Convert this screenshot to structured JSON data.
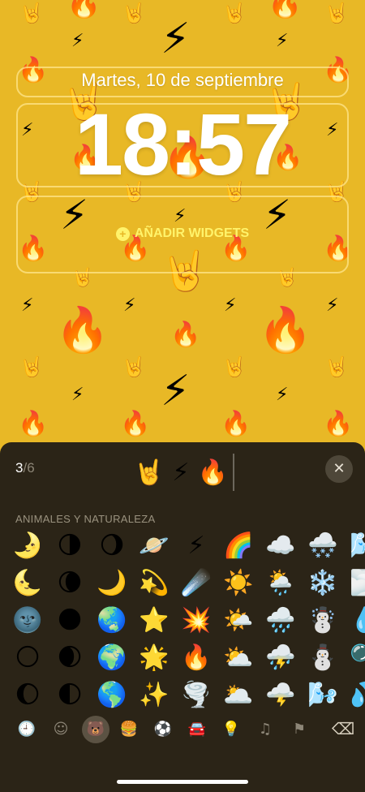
{
  "lockscreen": {
    "date": "Martes, 10 de septiembre",
    "time": "18:57",
    "add_widgets": "AÑADIR WIDGETS",
    "add_icon": "plus-circle-icon",
    "background_color": "#e8b826"
  },
  "picker": {
    "counter_current": "3",
    "counter_total": "/6",
    "selected_emojis": [
      "🤘",
      "⚡",
      "🔥"
    ],
    "close_icon": "close-icon",
    "category_title": "ANIMALES Y NATURALEZA",
    "emoji_rows": [
      [
        "🌛",
        "🌗",
        "🌖",
        "🪐",
        "⚡",
        "🌈",
        "☁️",
        "🌨️",
        "🌬️"
      ],
      [
        "🌜",
        "🌘",
        "🌙",
        "💫",
        "☄️",
        "☀️",
        "🌦️",
        "❄️",
        "🌫️"
      ],
      [
        "🌚",
        "🌑",
        "🌏",
        "⭐",
        "💥",
        "🌤️",
        "🌧️",
        "☃️",
        "💧"
      ],
      [
        "🌕",
        "🌒",
        "🌍",
        "🌟",
        "🔥",
        "⛅",
        "⛈️",
        "⛄",
        "🫧"
      ],
      [
        "🌔",
        "🌓",
        "🌎",
        "✨",
        "🌪️",
        "🌥️",
        "🌩️",
        "🌬️",
        "💦"
      ]
    ],
    "tabs": [
      {
        "name": "recents-icon",
        "glyph": "🕘"
      },
      {
        "name": "smileys-icon",
        "glyph": "☺"
      },
      {
        "name": "animals-nature-icon",
        "glyph": "🐻"
      },
      {
        "name": "food-icon",
        "glyph": "🍔"
      },
      {
        "name": "activity-icon",
        "glyph": "⚽"
      },
      {
        "name": "travel-icon",
        "glyph": "🚘"
      },
      {
        "name": "objects-icon",
        "glyph": "💡"
      },
      {
        "name": "symbols-icon",
        "glyph": "♫"
      },
      {
        "name": "flags-icon",
        "glyph": "⚑"
      }
    ],
    "active_tab": "animals-nature-icon",
    "delete_icon": "delete-backspace-icon",
    "delete_glyph": "⌫"
  }
}
